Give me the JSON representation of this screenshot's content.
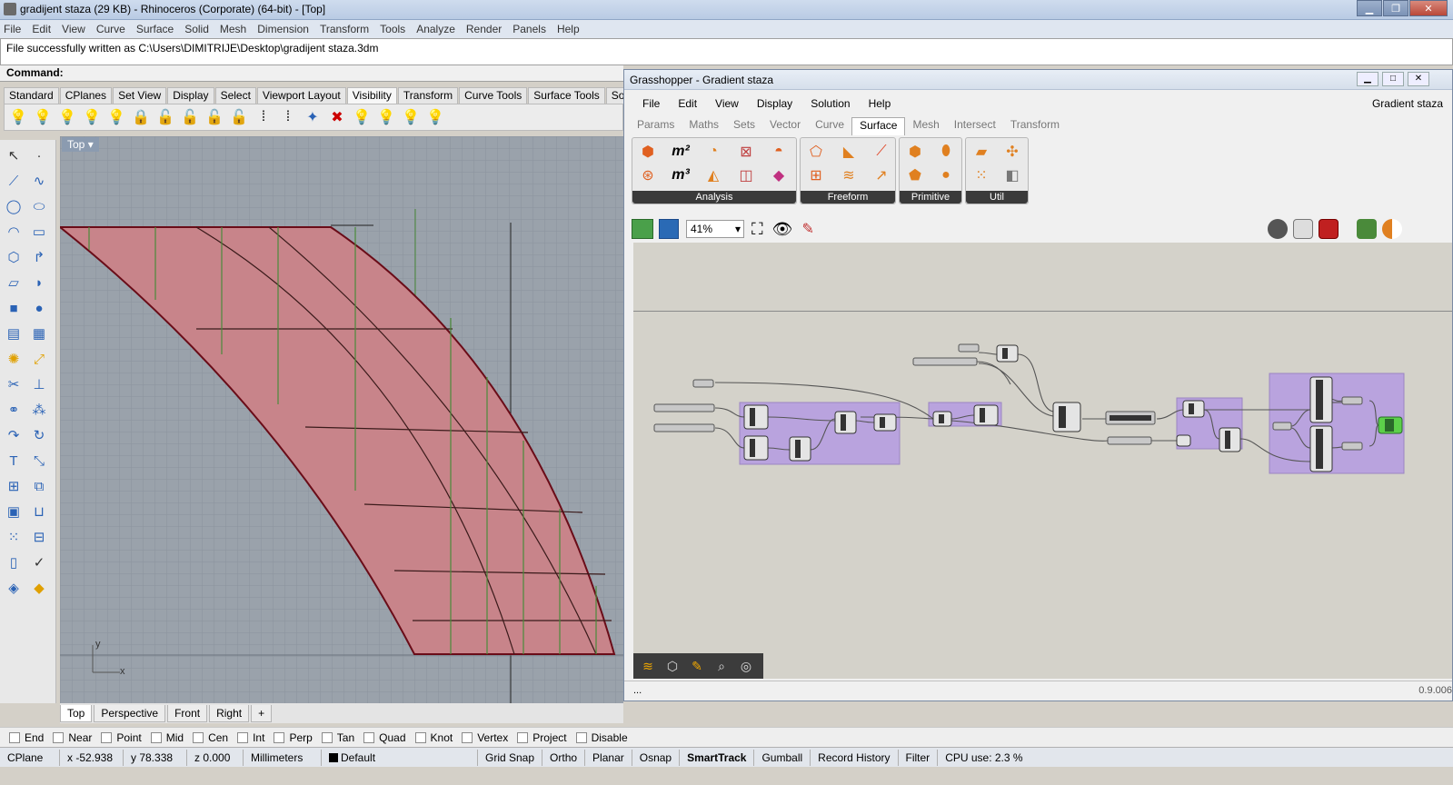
{
  "window": {
    "title": "gradijent staza (29 KB) - Rhinoceros (Corporate) (64-bit) - [Top]"
  },
  "menu": [
    "File",
    "Edit",
    "View",
    "Curve",
    "Surface",
    "Solid",
    "Mesh",
    "Dimension",
    "Transform",
    "Tools",
    "Analyze",
    "Render",
    "Panels",
    "Help"
  ],
  "history": {
    "message": "File successfully written as C:\\Users\\DIMITRIJE\\Desktop\\gradijent staza.3dm"
  },
  "command": {
    "label": "Command:"
  },
  "rhino_tabs": [
    "Standard",
    "CPlanes",
    "Set View",
    "Display",
    "Select",
    "Viewport Layout",
    "Visibility",
    "Transform",
    "Curve Tools",
    "Surface Tools",
    "Solid"
  ],
  "rhino_tabs_active": "Visibility",
  "viewport": {
    "label": "Top",
    "axis_x": "x",
    "axis_y": "y"
  },
  "viewport_tabs": [
    "Top",
    "Perspective",
    "Front",
    "Right"
  ],
  "viewport_tabs_add": "+",
  "osnaps": [
    "End",
    "Near",
    "Point",
    "Mid",
    "Cen",
    "Int",
    "Perp",
    "Tan",
    "Quad",
    "Knot",
    "Vertex",
    "Project",
    "Disable"
  ],
  "status": {
    "cplane": "CPlane",
    "x": "x -52.938",
    "y": "y 78.338",
    "z": "z 0.000",
    "units": "Millimeters",
    "layer": "Default",
    "grid_snap": "Grid Snap",
    "ortho": "Ortho",
    "planar": "Planar",
    "osnap": "Osnap",
    "smarttrack": "SmartTrack",
    "gumball": "Gumball",
    "record_history": "Record History",
    "filter": "Filter",
    "cpu": "CPU use: 2.3 %"
  },
  "grasshopper": {
    "title": "Grasshopper - Gradient staza",
    "doc_name": "Gradient staza",
    "menu": [
      "File",
      "Edit",
      "View",
      "Display",
      "Solution",
      "Help"
    ],
    "tabs": [
      "Params",
      "Maths",
      "Sets",
      "Vector",
      "Curve",
      "Surface",
      "Mesh",
      "Intersect",
      "Transform"
    ],
    "active_tab": "Surface",
    "panels": [
      "Analysis",
      "Freeform",
      "Primitive",
      "Util"
    ],
    "zoom": "41%",
    "status_left": "...",
    "version": "0.9.006"
  },
  "colors": {
    "surface_fill": "#c8848a",
    "group_purple": "#b9a3de",
    "viewport_bg": "#9aa2ab"
  }
}
